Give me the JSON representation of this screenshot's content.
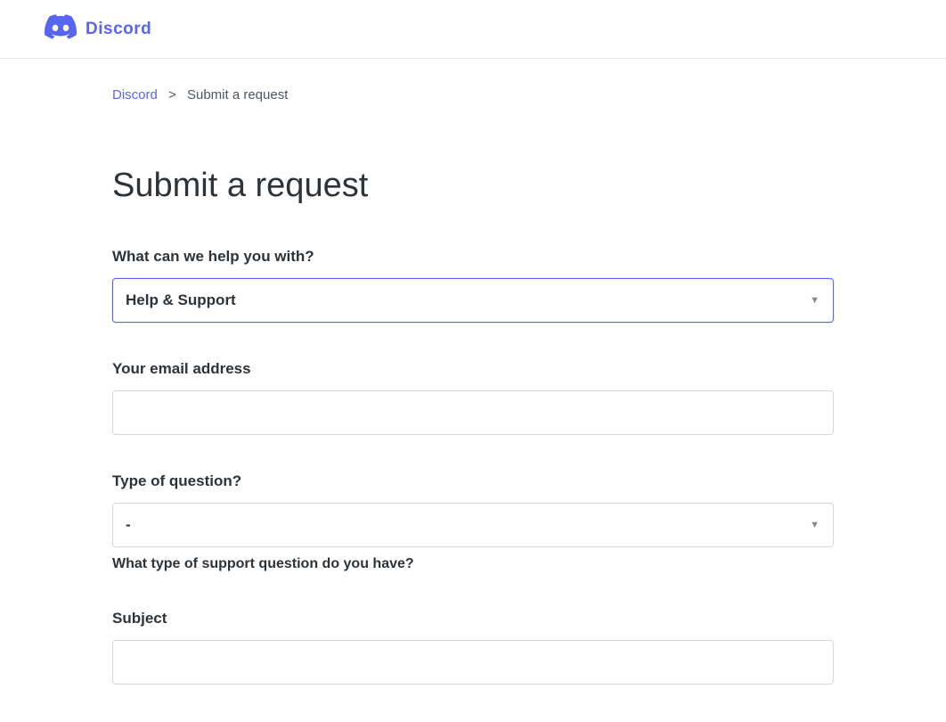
{
  "header": {
    "brand_text": "Discord"
  },
  "breadcrumb": {
    "home_label": "Discord",
    "separator": ">",
    "current_label": "Submit a request"
  },
  "page": {
    "title": "Submit a request"
  },
  "form": {
    "topic": {
      "label": "What can we help you with?",
      "selected": "Help & Support"
    },
    "email": {
      "label": "Your email address",
      "value": ""
    },
    "question_type": {
      "label": "Type of question?",
      "selected": "-",
      "help_text": "What type of support question do you have?"
    },
    "subject": {
      "label": "Subject",
      "value": ""
    }
  }
}
